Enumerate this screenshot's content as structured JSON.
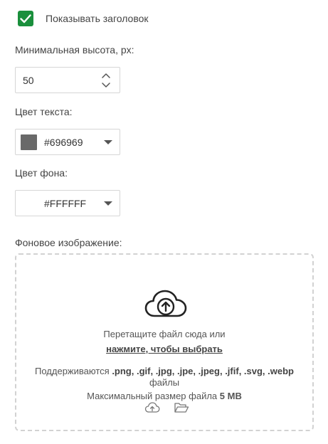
{
  "show_title": {
    "label": "Показывать заголовок",
    "checked": true,
    "check_color": "#1a8f3c"
  },
  "min_height": {
    "label": "Минимальная высота, px:",
    "value": "50"
  },
  "text_color": {
    "label": "Цвет текста:",
    "value": "#696969",
    "swatch": "#696969"
  },
  "bg_color": {
    "label": "Цвет фона:",
    "value": "#FFFFFF",
    "swatch": "#FFFFFF"
  },
  "bg_image": {
    "label": "Фоновое изображение:",
    "drop_text": "Перетащите файл сюда или",
    "click_text": "нажмите, чтобы выбрать",
    "supported_prefix": "Поддерживаются",
    "formats": ".png, .gif, .jpg, .jpe, .jpeg, .jfif, .svg, .webp",
    "formats_suffix": "файлы",
    "max_size_prefix": "Максимальный размер файла",
    "max_size_value": "5 MB",
    "icons": [
      "cloud-upload-icon",
      "upload-icon",
      "folder-open-icon"
    ]
  }
}
